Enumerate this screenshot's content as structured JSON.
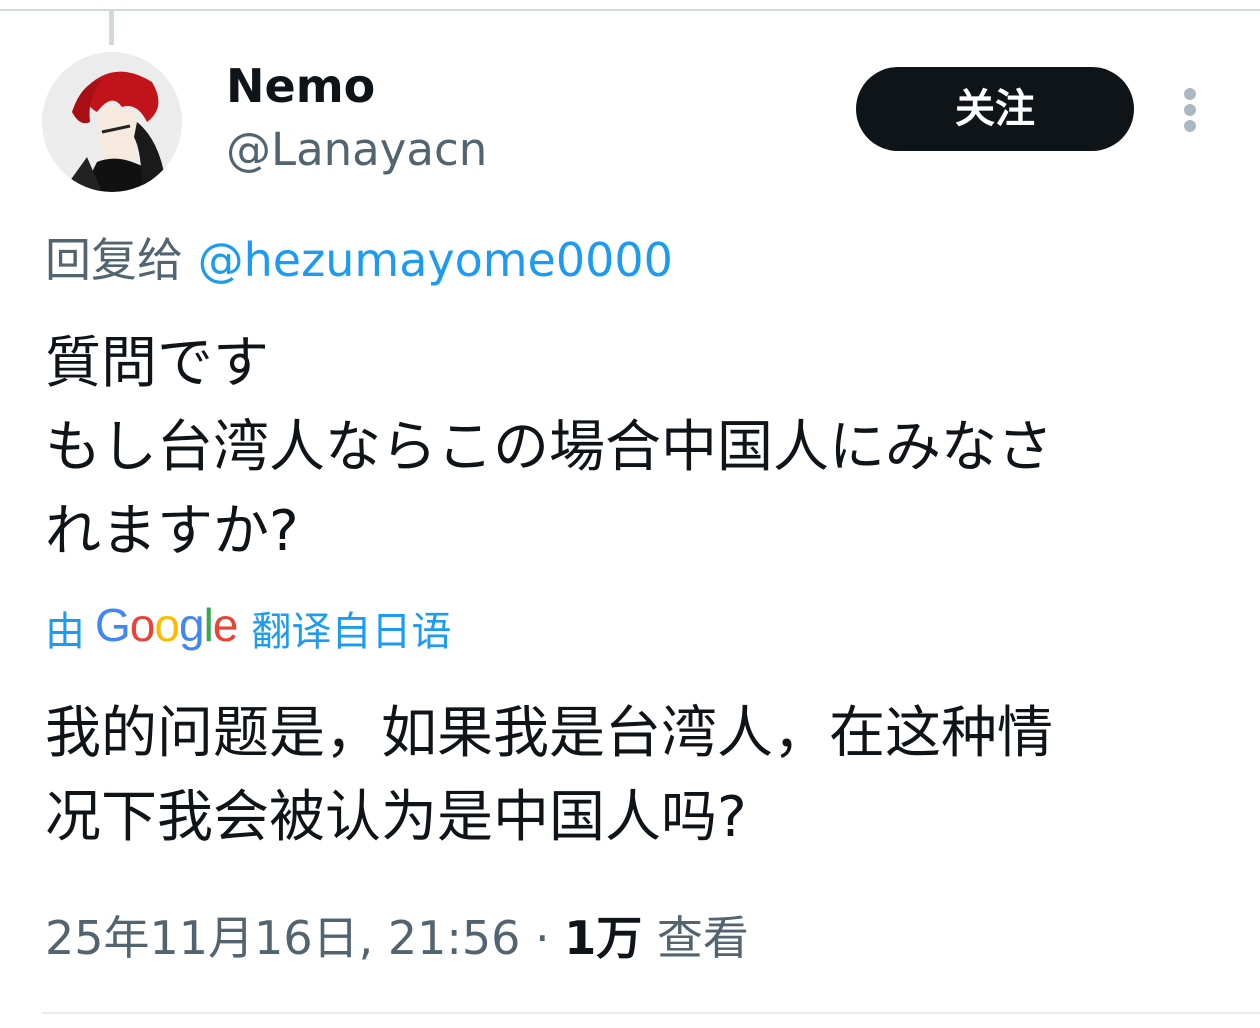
{
  "author": {
    "display_name": "Nemo",
    "handle": "@Lanayacn",
    "avatar_icon": "avatar-red-haired-anime-character"
  },
  "follow_button": {
    "label": "关注"
  },
  "more_icon": "vertical-ellipsis-icon",
  "reply": {
    "prefix": "回复给 ",
    "to_handle": "@hezumayome0000"
  },
  "tweet": {
    "lines": [
      "質問です",
      "もし台湾人ならこの場合中国人にみなさ",
      "れますか?"
    ]
  },
  "translation": {
    "prefix": "由",
    "provider": "Google",
    "suffix": "翻译自日语",
    "lines": [
      "我的问题是，如果我是台湾人，在这种情",
      "况下我会被认为是中国人吗?"
    ]
  },
  "meta": {
    "timestamp": "25年11月16日, 21:56",
    "separator": " · ",
    "views_count": "1万",
    "views_label": " 查看"
  },
  "colors": {
    "text_primary": "#0f1419",
    "text_secondary": "#536471",
    "link_blue": "#1d9bf0",
    "follow_button_bg": "#0f1419",
    "divider": "#cfd9de"
  }
}
